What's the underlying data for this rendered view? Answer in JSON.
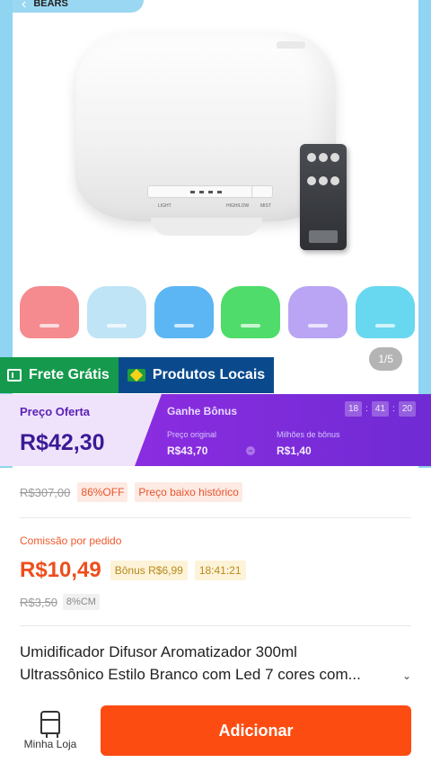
{
  "header": {
    "back_icon": "chevron-left-icon",
    "brand": "BEARS"
  },
  "gallery": {
    "page_indicator": "1/5",
    "thumb_colors": [
      "#f58a8f",
      "#bfe4f5",
      "#5cb6f3",
      "#4fdc6a",
      "#b9a5f3",
      "#67d8ef"
    ]
  },
  "tags": {
    "frete": "Frete Grátis",
    "local": "Produtos Locais"
  },
  "price_band": {
    "label": "Preço Oferta",
    "price": "R$42,30",
    "title": "Ganhe Bônus",
    "timer": [
      "18",
      "41",
      "20"
    ],
    "original_label": "Preço original",
    "original_value": "R$43,70",
    "bonus_label": "Milhões de bônus",
    "bonus_value": "R$1,40"
  },
  "pricing": {
    "old_price": "R$307,00",
    "discount": "86%OFF",
    "history_tag": "Preço baixo histórico"
  },
  "commission": {
    "label": "Comissão por pedido",
    "value": "R$10,49",
    "bonus": "Bônus R$6,99",
    "timer": "18:41:21",
    "old_value": "R$3,50",
    "cm": "8%CM"
  },
  "product": {
    "title_line1": "Umidificador Difusor Aromatizador 300ml",
    "title_line2": "Ultrassônico Estilo Branco com Led 7 cores com..."
  },
  "bottom_bar": {
    "store_label": "Minha Loja",
    "add_label": "Adicionar"
  }
}
